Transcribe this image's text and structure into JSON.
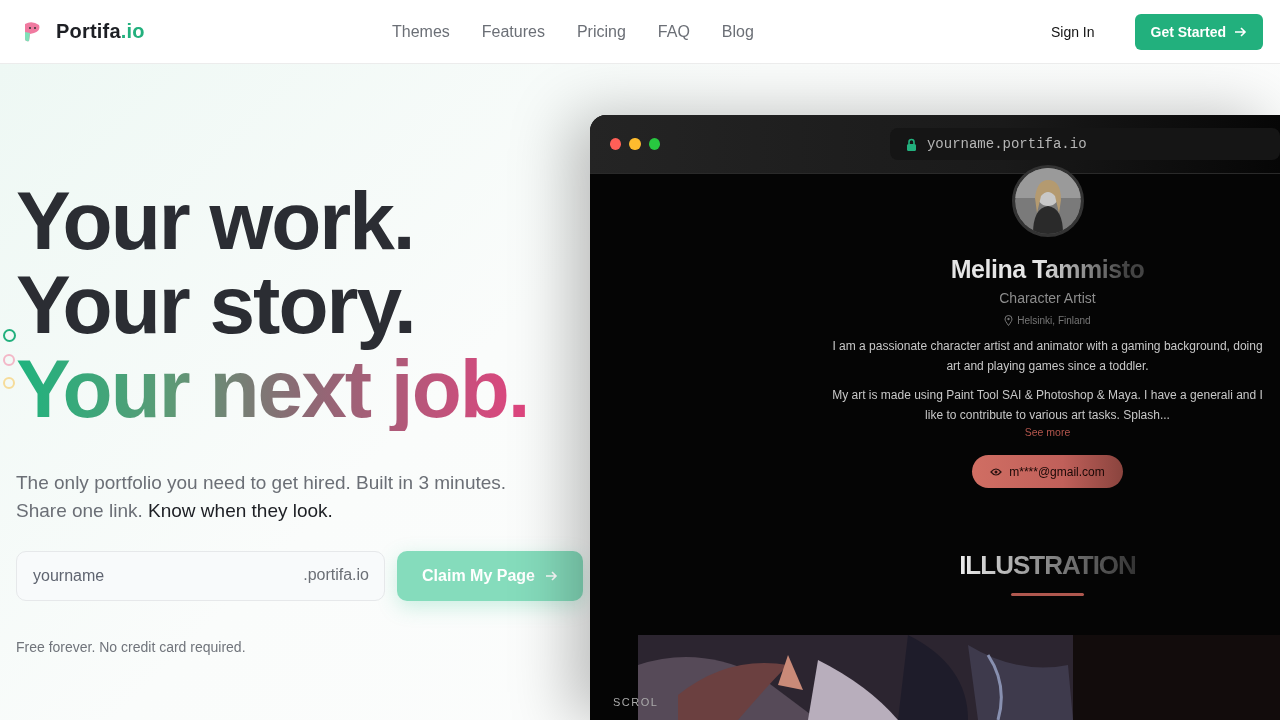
{
  "brand": {
    "name": "Portifa",
    "suffix": ".io"
  },
  "nav": [
    {
      "label": "Themes"
    },
    {
      "label": "Features"
    },
    {
      "label": "Pricing"
    },
    {
      "label": "FAQ"
    },
    {
      "label": "Blog"
    }
  ],
  "sign_in": "Sign In",
  "get_started": "Get Started",
  "hero": {
    "lines": [
      {
        "text": "Your work.",
        "kind": "plain"
      },
      {
        "text": "Your story.",
        "kind": "plain"
      },
      {
        "text": "Your next job.",
        "kind": "gradient"
      }
    ],
    "subtitle": "The only portfolio you need to get hired. Built in 3 minutes. Share one link. **Know when they look.**",
    "signup": {
      "placeholder": "yourname",
      "suffix": ".portifa.io",
      "button": "Claim My Page"
    },
    "note": "Free forever. No credit card required."
  },
  "preview": {
    "url": "yourname.portifa.io",
    "name": "Melina Tammisto",
    "role": "Character Artist",
    "location": "Helsinki, Finland",
    "bio": [
      "I am a passionate character artist and animator with a gaming background, doing art and playing games since a toddler.",
      "My art is made using Paint Tool SAI & Photoshop & Maya. I have a generali and I like to contribute to various art tasks. Splash..."
    ],
    "see_more": "See more",
    "email": "m****@gmail.com",
    "section_title": "ILLUSTRATION",
    "scroll_hint": "SCROL"
  }
}
